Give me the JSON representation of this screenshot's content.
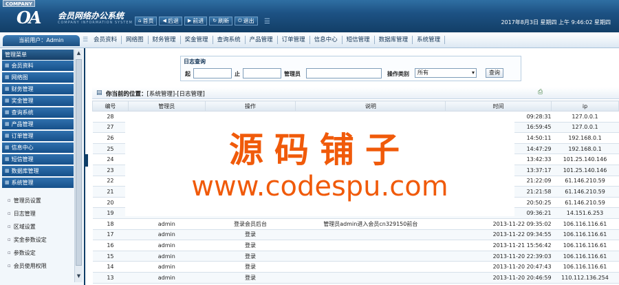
{
  "header": {
    "company": "COMPANY",
    "logo": "OA",
    "title": "会员网络办公系统",
    "subtitle": "COMPANY INFORMATION SYSTEM",
    "buttons": [
      {
        "icon": "home-icon",
        "label": "首页"
      },
      {
        "icon": "back-icon",
        "label": "后退"
      },
      {
        "icon": "forward-icon",
        "label": "前进"
      },
      {
        "icon": "refresh-icon",
        "label": "刷新"
      },
      {
        "icon": "power-icon",
        "label": "退出"
      }
    ],
    "datetime": "2017年8月3日 星期四 上午 9:46:02 星期四"
  },
  "nav": {
    "current_user": "当前用户：Admin",
    "items": [
      "会员资料",
      "网络图",
      "财务管理",
      "奖金管理",
      "查询系统",
      "产品管理",
      "订单管理",
      "信息中心",
      "短信管理",
      "数据库管理",
      "系统管理"
    ]
  },
  "sidebar": {
    "header": "管理菜单",
    "items": [
      "会员资料",
      "网络图",
      "财务管理",
      "奖金管理",
      "查询系统",
      "产品管理",
      "订单管理",
      "信息中心",
      "短信管理",
      "数据库管理",
      "系统管理"
    ],
    "sub_items": [
      "管理员设置",
      "日志管理",
      "区域设置",
      "奖金参数设定",
      "参数设定",
      "会员使用权限"
    ]
  },
  "search": {
    "title": "日志查询",
    "start_label": "起",
    "end_label": "止",
    "admin_label": "管理员",
    "type_label": "操作类别",
    "type_value": "所有",
    "button": "查询"
  },
  "location": {
    "prefix": "你当前的位置：",
    "path": "[系统管理]-[日志管理]"
  },
  "table": {
    "headers": [
      "编号",
      "管理员",
      "操作",
      "说明",
      "时间",
      "ip"
    ],
    "rows": [
      [
        "28",
        "",
        "",
        "",
        "09:28:31",
        "127.0.0.1"
      ],
      [
        "27",
        "",
        "",
        "",
        "16:59:45",
        "127.0.0.1"
      ],
      [
        "26",
        "",
        "",
        "",
        "14:50:11",
        "192.168.0.1"
      ],
      [
        "25",
        "",
        "",
        "",
        "14:47:29",
        "192.168.0.1"
      ],
      [
        "24",
        "",
        "",
        "",
        "13:42:33",
        "101.25.140.146"
      ],
      [
        "23",
        "",
        "",
        "",
        "13:37:17",
        "101.25.140.146"
      ],
      [
        "22",
        "",
        "",
        "",
        "21:22:09",
        "61.146.210.59"
      ],
      [
        "21",
        "",
        "",
        "",
        "21:21:58",
        "61.146.210.59"
      ],
      [
        "20",
        "",
        "",
        "",
        "20:50:25",
        "61.146.210.59"
      ],
      [
        "19",
        "",
        "",
        "",
        "09:36:21",
        "14.151.6.253"
      ],
      [
        "18",
        "admin",
        "登录会员后台",
        "管理员admin进入会员cn329150前台",
        "2013-11-22 09:35:02",
        "106.116.116.61"
      ],
      [
        "17",
        "admin",
        "登录",
        "",
        "2013-11-22 09:34:55",
        "106.116.116.61"
      ],
      [
        "16",
        "admin",
        "登录",
        "",
        "2013-11-21 15:56:42",
        "106.116.116.61"
      ],
      [
        "15",
        "admin",
        "登录",
        "",
        "2013-11-20 22:39:03",
        "106.116.116.61"
      ],
      [
        "14",
        "admin",
        "登录",
        "",
        "2013-11-20 20:47:43",
        "106.116.116.61"
      ],
      [
        "13",
        "admin",
        "登录",
        "",
        "2013-11-20 20:46:59",
        "110.112.136.254"
      ]
    ]
  },
  "watermark": {
    "cn": "源码铺子",
    "url": "www.codespu.com"
  },
  "colors": {
    "header_bg": "#1d5284",
    "sidebar_item": "#2f70ad",
    "watermark": "#f05a0a"
  }
}
